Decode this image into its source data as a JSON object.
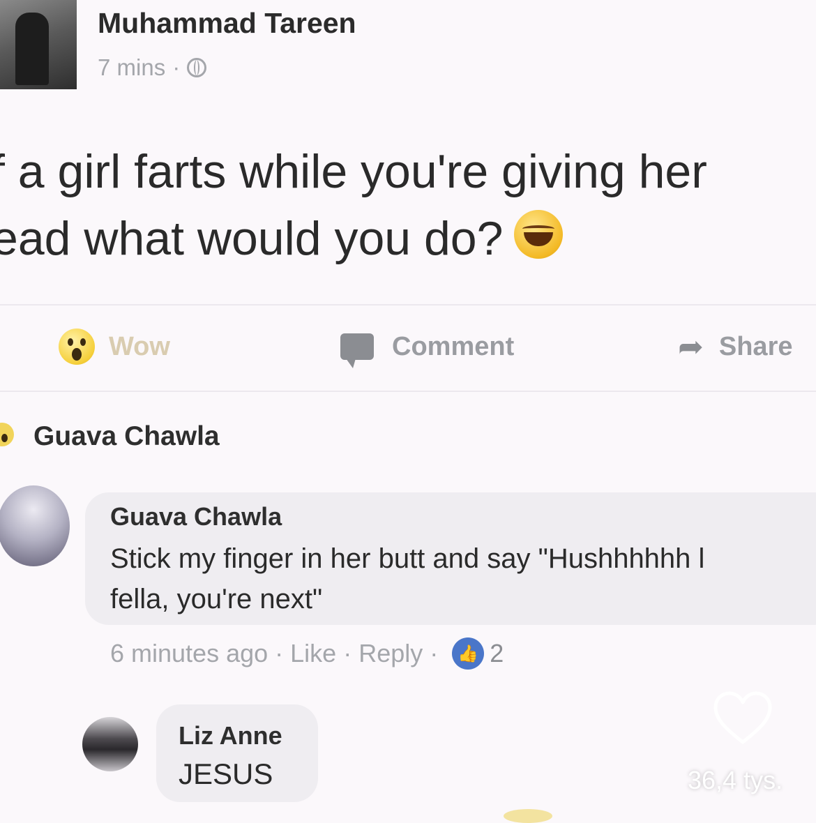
{
  "post": {
    "author": "Muhammad Tareen",
    "time": "7 mins",
    "meta_separator": "·",
    "privacy_icon": "globe-icon",
    "text_line1": "f a girl farts while you're giving her",
    "text_line2": "ead what would you do?",
    "text_emoji": "laughing-tears-emoji"
  },
  "actions": {
    "wow": "Wow",
    "comment": "Comment",
    "share": "Share"
  },
  "top_comment_header": {
    "name": "Guava Chawla"
  },
  "comments": [
    {
      "name": "Guava Chawla",
      "text_line1": "Stick my finger in her butt and say \"Hushhhhhh l",
      "text_line2": "fella, you're next\"",
      "time": "6 minutes ago",
      "like": "Like",
      "reply": "Reply",
      "separator": "·",
      "reaction_count": "2"
    },
    {
      "name": "Liz Anne",
      "text": "JESUS"
    }
  ],
  "overlay": {
    "like_count": "36,4 tys."
  },
  "colors": {
    "background": "#fbf8fb",
    "bubble": "#efedf1",
    "muted_text": "#a4a6ab",
    "like_badge": "#4a76c9"
  }
}
